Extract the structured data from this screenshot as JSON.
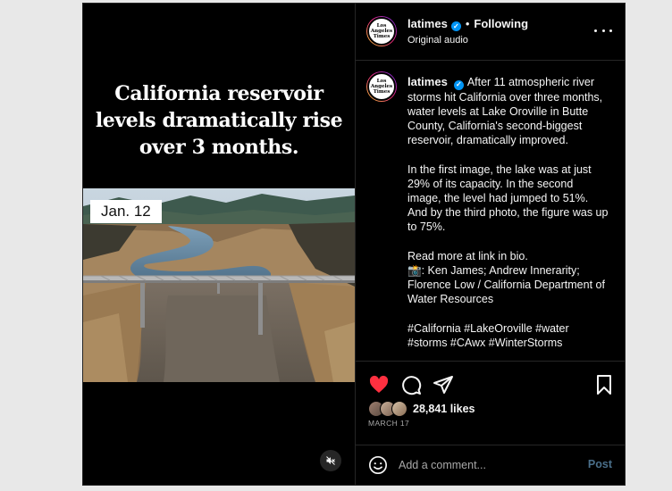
{
  "post": {
    "headline": "California reservoir levels dramatically rise over 3 months.",
    "date_tag": "Jan. 12",
    "mute_icon": "speaker-muted-icon"
  },
  "header": {
    "username": "latimes",
    "separator": "•",
    "follow_state": "Following",
    "audio": "Original audio",
    "avatar_text": "Los Angeles Times"
  },
  "caption": {
    "username": "latimes",
    "text": "After 11 atmospheric river storms hit California over three months, water levels at Lake Oroville in Butte County, California's second-biggest reservoir, dramatically improved.\n\nIn the first image, the lake was at just 29% of its capacity. In the second image, the level had jumped to 51%. And by the third photo, the figure was up to 75%.\n\nRead more at link in bio.\n📸: Ken James; Andrew Innerarity; Florence Low / California Department of Water Resources\n\n#California #LakeOroville #water #storms #CAwx #WinterStorms"
  },
  "actions": {
    "likes": "28,841 likes",
    "date": "MARCH 17",
    "like_color": "#ff3040"
  },
  "comment": {
    "placeholder": "Add a comment...",
    "post_label": "Post"
  },
  "colors": {
    "background": "#000000",
    "verified": "#0095f6",
    "post_disabled": "#4a6f8a"
  }
}
